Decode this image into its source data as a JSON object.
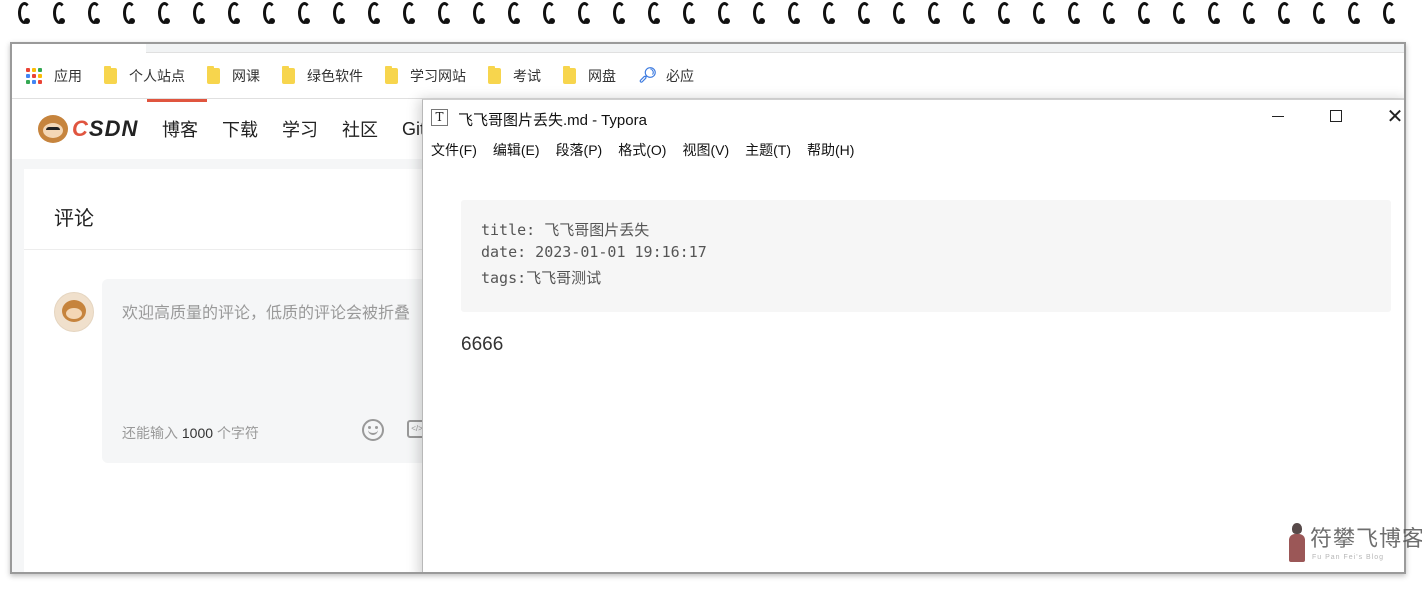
{
  "bookmarks": {
    "items": [
      {
        "label": "应用",
        "icon": "apps-icon"
      },
      {
        "label": "个人站点",
        "icon": "folder-icon"
      },
      {
        "label": "网课",
        "icon": "folder-icon"
      },
      {
        "label": "绿色软件",
        "icon": "folder-icon"
      },
      {
        "label": "学习网站",
        "icon": "folder-icon"
      },
      {
        "label": "考试",
        "icon": "folder-icon"
      },
      {
        "label": "网盘",
        "icon": "folder-icon"
      },
      {
        "label": "必应",
        "icon": "search-icon"
      }
    ]
  },
  "csdn": {
    "logo_text": "CSDN",
    "nav": [
      "博客",
      "下载",
      "学习",
      "社区",
      "Git"
    ],
    "brand_color": "#e0553f"
  },
  "comment": {
    "title": "评论",
    "placeholder": "欢迎高质量的评论，低质的评论会被折叠",
    "count_prefix": "还能输入",
    "count_value": "1000",
    "count_suffix": "个字符"
  },
  "typora": {
    "title": "飞飞哥图片丢失.md - Typora",
    "app_icon": "T",
    "menu": [
      "文件(F)",
      "编辑(E)",
      "段落(P)",
      "格式(O)",
      "视图(V)",
      "主题(T)",
      "帮助(H)"
    ],
    "frontmatter": [
      "title: 飞飞哥图片丢失",
      "date: 2023-01-01 19:16:17",
      "tags:飞飞哥测试"
    ],
    "body": "6666"
  },
  "watermark": {
    "text": "符攀飞博客",
    "sub": "Fu Pan Fei's Blog"
  }
}
